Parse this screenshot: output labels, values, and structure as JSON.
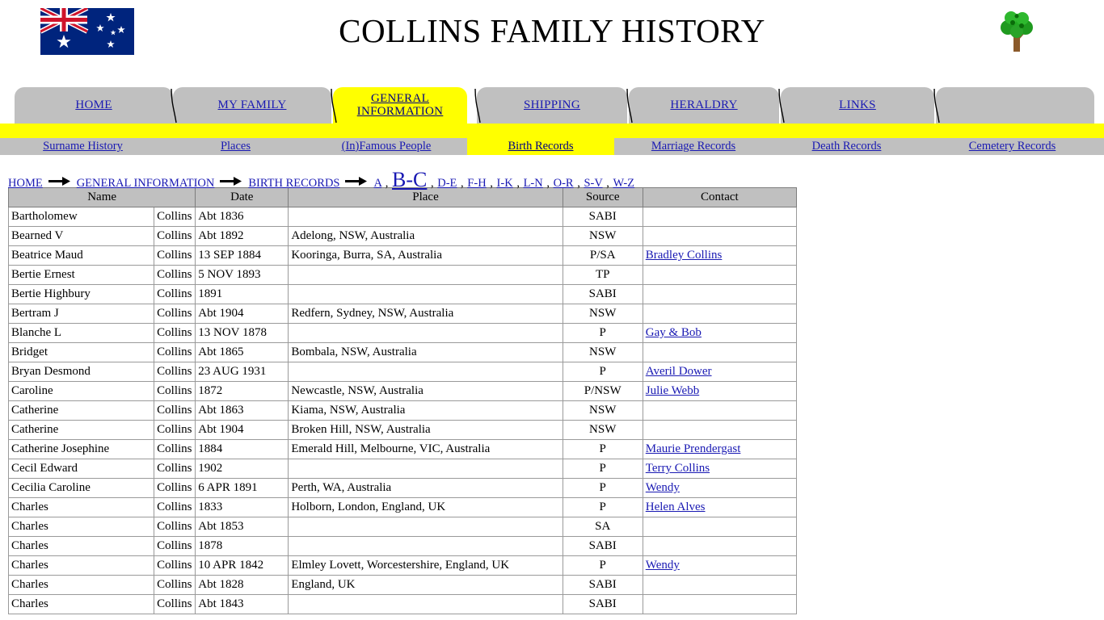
{
  "header": {
    "title": "COLLINS FAMILY HISTORY",
    "flag_icon": "australian-flag-icon",
    "logo_icon": "family-tree-icon"
  },
  "tabs": [
    {
      "label": "HOME",
      "active": false
    },
    {
      "label": "MY FAMILY",
      "active": false
    },
    {
      "label": "GENERAL INFORMATION",
      "active": true
    },
    {
      "label": "SHIPPING",
      "active": false
    },
    {
      "label": "HERALDRY",
      "active": false
    },
    {
      "label": "LINKS",
      "active": false
    },
    {
      "label": "",
      "active": false
    }
  ],
  "subnav": [
    {
      "label": "Surname History",
      "active": false
    },
    {
      "label": "Places",
      "active": false
    },
    {
      "label": "(In)Famous People",
      "active": false
    },
    {
      "label": "Birth Records",
      "active": true
    },
    {
      "label": "Marriage Records",
      "active": false
    },
    {
      "label": "Death Records",
      "active": false
    },
    {
      "label": "Cemetery Records",
      "active": false
    }
  ],
  "breadcrumb": {
    "trail": [
      "HOME",
      "GENERAL INFORMATION",
      "BIRTH RECORDS"
    ],
    "letters": [
      "A",
      "B-C",
      "D-E",
      "F-H",
      "I-K",
      "L-N",
      "O-R",
      "S-V",
      "W-Z"
    ],
    "current_letter": "B-C",
    "separator": ","
  },
  "table": {
    "columns": [
      "Name",
      "Date",
      "Place",
      "Source",
      "Contact"
    ],
    "rows": [
      {
        "given": "Bartholomew",
        "surname": "Collins",
        "date": "Abt 1836",
        "place": "",
        "source": "SABI",
        "contact": ""
      },
      {
        "given": "Bearned V",
        "surname": "Collins",
        "date": "Abt 1892",
        "place": "Adelong, NSW, Australia",
        "source": "NSW",
        "contact": ""
      },
      {
        "given": "Beatrice Maud",
        "surname": "Collins",
        "date": "13 SEP 1884",
        "place": "Kooringa, Burra, SA, Australia",
        "source": "P/SA",
        "contact": "Bradley Collins"
      },
      {
        "given": "Bertie Ernest",
        "surname": "Collins",
        "date": "5 NOV 1893",
        "place": "",
        "source": "TP",
        "contact": ""
      },
      {
        "given": "Bertie Highbury",
        "surname": "Collins",
        "date": "1891",
        "place": "",
        "source": "SABI",
        "contact": ""
      },
      {
        "given": "Bertram J",
        "surname": "Collins",
        "date": "Abt 1904",
        "place": "Redfern, Sydney, NSW, Australia",
        "source": "NSW",
        "contact": ""
      },
      {
        "given": "Blanche L",
        "surname": "Collins",
        "date": "13 NOV 1878",
        "place": "",
        "source": "P",
        "contact": "Gay & Bob"
      },
      {
        "given": "Bridget",
        "surname": "Collins",
        "date": "Abt 1865",
        "place": "Bombala, NSW, Australia",
        "source": "NSW",
        "contact": ""
      },
      {
        "given": "Bryan Desmond",
        "surname": "Collins",
        "date": "23 AUG 1931",
        "place": "",
        "source": "P",
        "contact": "Averil Dower"
      },
      {
        "given": "Caroline",
        "surname": "Collins",
        "date": "1872",
        "place": "Newcastle, NSW, Australia",
        "source": "P/NSW",
        "contact": "Julie Webb"
      },
      {
        "given": "Catherine",
        "surname": "Collins",
        "date": "Abt 1863",
        "place": "Kiama, NSW, Australia",
        "source": "NSW",
        "contact": ""
      },
      {
        "given": "Catherine",
        "surname": "Collins",
        "date": "Abt 1904",
        "place": "Broken Hill, NSW, Australia",
        "source": "NSW",
        "contact": ""
      },
      {
        "given": "Catherine Josephine",
        "surname": "Collins",
        "date": "1884",
        "place": "Emerald Hill, Melbourne, VIC, Australia",
        "source": "P",
        "contact": "Maurie Prendergast"
      },
      {
        "given": "Cecil Edward",
        "surname": "Collins",
        "date": "1902",
        "place": "",
        "source": "P",
        "contact": "Terry Collins"
      },
      {
        "given": "Cecilia Caroline",
        "surname": "Collins",
        "date": "6 APR 1891",
        "place": "Perth, WA, Australia",
        "source": "P",
        "contact": "Wendy"
      },
      {
        "given": "Charles",
        "surname": "Collins",
        "date": "1833",
        "place": "Holborn, London, England, UK",
        "source": "P",
        "contact": "Helen Alves"
      },
      {
        "given": "Charles",
        "surname": "Collins",
        "date": "Abt 1853",
        "place": "",
        "source": "SA",
        "contact": ""
      },
      {
        "given": "Charles",
        "surname": "Collins",
        "date": "1878",
        "place": "",
        "source": "SABI",
        "contact": ""
      },
      {
        "given": "Charles",
        "surname": "Collins",
        "date": "10 APR 1842",
        "place": "Elmley Lovett, Worcestershire, England, UK",
        "source": "P",
        "contact": "Wendy"
      },
      {
        "given": "Charles",
        "surname": "Collins",
        "date": "Abt 1828",
        "place": "England, UK",
        "source": "SABI",
        "contact": ""
      },
      {
        "given": "Charles",
        "surname": "Collins",
        "date": "Abt 1843",
        "place": "",
        "source": "SABI",
        "contact": ""
      }
    ]
  },
  "colors": {
    "tab_bg": "#c0c0c0",
    "tab_active_bg": "#ffff00",
    "link": "#1919b3",
    "header_bg": "#c0c0c0"
  }
}
